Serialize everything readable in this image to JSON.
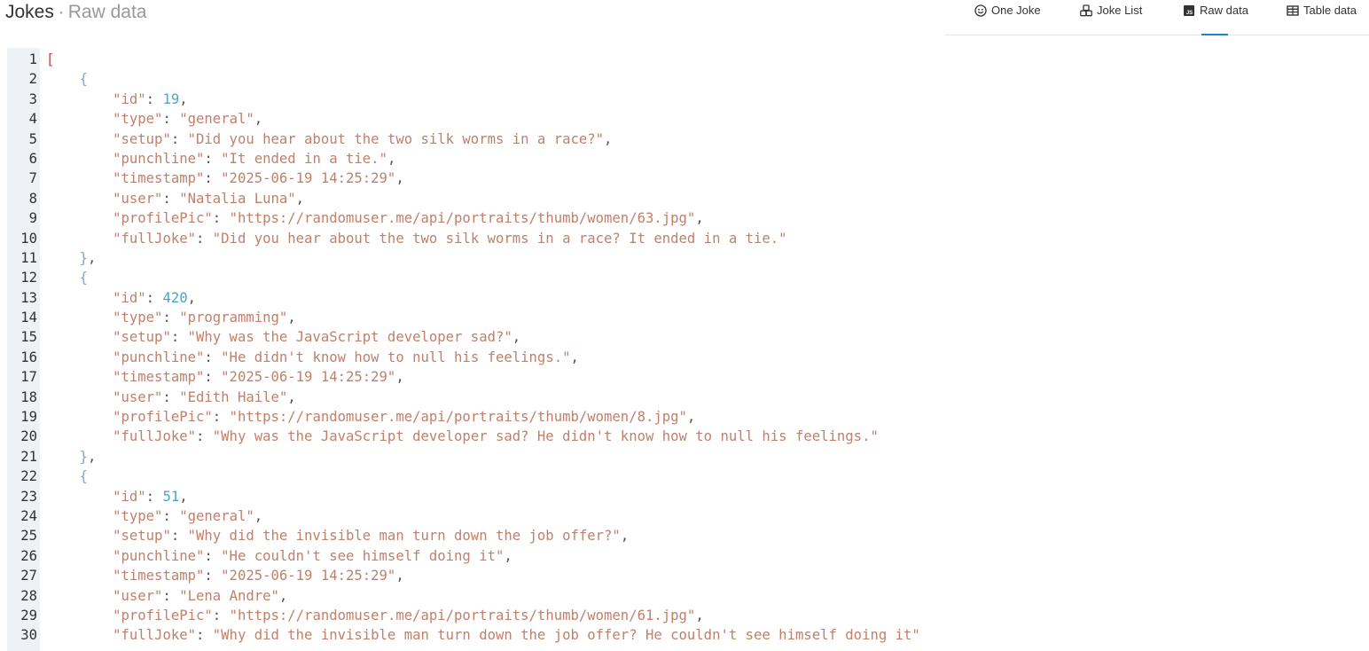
{
  "header": {
    "app": "Jokes",
    "separator": "·",
    "subtitle": "Raw data"
  },
  "tabs": [
    {
      "label": "One Joke",
      "icon": "smiley-icon",
      "active": false
    },
    {
      "label": "Joke List",
      "icon": "cubes-icon",
      "active": false
    },
    {
      "label": "Raw data",
      "icon": "js-file-icon",
      "active": true
    },
    {
      "label": "Table data",
      "icon": "table-icon",
      "active": false
    }
  ],
  "colors": {
    "accent": "#1e88c7",
    "string": "#c0806a",
    "number": "#4fa3c8",
    "gutter": "#eef1f5"
  },
  "code": [
    {
      "n": "1",
      "indent": 0,
      "parts": [
        [
          "bracket",
          "["
        ]
      ]
    },
    {
      "n": "2",
      "indent": 1,
      "parts": [
        [
          "brace",
          "{"
        ]
      ]
    },
    {
      "n": "3",
      "indent": 2,
      "parts": [
        [
          "key",
          "\"id\""
        ],
        [
          "punc",
          ": "
        ],
        [
          "num",
          "19"
        ],
        [
          "punc",
          ","
        ]
      ]
    },
    {
      "n": "4",
      "indent": 2,
      "parts": [
        [
          "key",
          "\"type\""
        ],
        [
          "punc",
          ": "
        ],
        [
          "str",
          "\"general\""
        ],
        [
          "punc",
          ","
        ]
      ]
    },
    {
      "n": "5",
      "indent": 2,
      "parts": [
        [
          "key",
          "\"setup\""
        ],
        [
          "punc",
          ": "
        ],
        [
          "str",
          "\"Did you hear about the two silk worms in a race?\""
        ],
        [
          "punc",
          ","
        ]
      ]
    },
    {
      "n": "6",
      "indent": 2,
      "parts": [
        [
          "key",
          "\"punchline\""
        ],
        [
          "punc",
          ": "
        ],
        [
          "str",
          "\"It ended in a tie.\""
        ],
        [
          "punc",
          ","
        ]
      ]
    },
    {
      "n": "7",
      "indent": 2,
      "parts": [
        [
          "key",
          "\"timestamp\""
        ],
        [
          "punc",
          ": "
        ],
        [
          "str",
          "\"2025-06-19 14:25:29\""
        ],
        [
          "punc",
          ","
        ]
      ]
    },
    {
      "n": "8",
      "indent": 2,
      "parts": [
        [
          "key",
          "\"user\""
        ],
        [
          "punc",
          ": "
        ],
        [
          "str",
          "\"Natalia Luna\""
        ],
        [
          "punc",
          ","
        ]
      ]
    },
    {
      "n": "9",
      "indent": 2,
      "parts": [
        [
          "key",
          "\"profilePic\""
        ],
        [
          "punc",
          ": "
        ],
        [
          "str",
          "\"https://randomuser.me/api/portraits/thumb/women/63.jpg\""
        ],
        [
          "punc",
          ","
        ]
      ]
    },
    {
      "n": "10",
      "indent": 2,
      "parts": [
        [
          "key",
          "\"fullJoke\""
        ],
        [
          "punc",
          ": "
        ],
        [
          "str",
          "\"Did you hear about the two silk worms in a race? It ended in a tie.\""
        ]
      ]
    },
    {
      "n": "11",
      "indent": 1,
      "parts": [
        [
          "brace",
          "}"
        ],
        [
          "punc",
          ","
        ]
      ]
    },
    {
      "n": "12",
      "indent": 1,
      "parts": [
        [
          "brace",
          "{"
        ]
      ]
    },
    {
      "n": "13",
      "indent": 2,
      "parts": [
        [
          "key",
          "\"id\""
        ],
        [
          "punc",
          ": "
        ],
        [
          "num",
          "420"
        ],
        [
          "punc",
          ","
        ]
      ]
    },
    {
      "n": "14",
      "indent": 2,
      "parts": [
        [
          "key",
          "\"type\""
        ],
        [
          "punc",
          ": "
        ],
        [
          "str",
          "\"programming\""
        ],
        [
          "punc",
          ","
        ]
      ]
    },
    {
      "n": "15",
      "indent": 2,
      "parts": [
        [
          "key",
          "\"setup\""
        ],
        [
          "punc",
          ": "
        ],
        [
          "str",
          "\"Why was the JavaScript developer sad?\""
        ],
        [
          "punc",
          ","
        ]
      ]
    },
    {
      "n": "16",
      "indent": 2,
      "parts": [
        [
          "key",
          "\"punchline\""
        ],
        [
          "punc",
          ": "
        ],
        [
          "str",
          "\"He didn't know how to null his feelings.\""
        ],
        [
          "punc",
          ","
        ]
      ]
    },
    {
      "n": "17",
      "indent": 2,
      "parts": [
        [
          "key",
          "\"timestamp\""
        ],
        [
          "punc",
          ": "
        ],
        [
          "str",
          "\"2025-06-19 14:25:29\""
        ],
        [
          "punc",
          ","
        ]
      ]
    },
    {
      "n": "18",
      "indent": 2,
      "parts": [
        [
          "key",
          "\"user\""
        ],
        [
          "punc",
          ": "
        ],
        [
          "str",
          "\"Edith Haile\""
        ],
        [
          "punc",
          ","
        ]
      ]
    },
    {
      "n": "19",
      "indent": 2,
      "parts": [
        [
          "key",
          "\"profilePic\""
        ],
        [
          "punc",
          ": "
        ],
        [
          "str",
          "\"https://randomuser.me/api/portraits/thumb/women/8.jpg\""
        ],
        [
          "punc",
          ","
        ]
      ]
    },
    {
      "n": "20",
      "indent": 2,
      "parts": [
        [
          "key",
          "\"fullJoke\""
        ],
        [
          "punc",
          ": "
        ],
        [
          "str",
          "\"Why was the JavaScript developer sad? He didn't know how to null his feelings.\""
        ]
      ]
    },
    {
      "n": "21",
      "indent": 1,
      "parts": [
        [
          "brace",
          "}"
        ],
        [
          "punc",
          ","
        ]
      ]
    },
    {
      "n": "22",
      "indent": 1,
      "parts": [
        [
          "brace",
          "{"
        ]
      ]
    },
    {
      "n": "23",
      "indent": 2,
      "parts": [
        [
          "key",
          "\"id\""
        ],
        [
          "punc",
          ": "
        ],
        [
          "num",
          "51"
        ],
        [
          "punc",
          ","
        ]
      ]
    },
    {
      "n": "24",
      "indent": 2,
      "parts": [
        [
          "key",
          "\"type\""
        ],
        [
          "punc",
          ": "
        ],
        [
          "str",
          "\"general\""
        ],
        [
          "punc",
          ","
        ]
      ]
    },
    {
      "n": "25",
      "indent": 2,
      "parts": [
        [
          "key",
          "\"setup\""
        ],
        [
          "punc",
          ": "
        ],
        [
          "str",
          "\"Why did the invisible man turn down the job offer?\""
        ],
        [
          "punc",
          ","
        ]
      ]
    },
    {
      "n": "26",
      "indent": 2,
      "parts": [
        [
          "key",
          "\"punchline\""
        ],
        [
          "punc",
          ": "
        ],
        [
          "str",
          "\"He couldn't see himself doing it\""
        ],
        [
          "punc",
          ","
        ]
      ]
    },
    {
      "n": "27",
      "indent": 2,
      "parts": [
        [
          "key",
          "\"timestamp\""
        ],
        [
          "punc",
          ": "
        ],
        [
          "str",
          "\"2025-06-19 14:25:29\""
        ],
        [
          "punc",
          ","
        ]
      ]
    },
    {
      "n": "28",
      "indent": 2,
      "parts": [
        [
          "key",
          "\"user\""
        ],
        [
          "punc",
          ": "
        ],
        [
          "str",
          "\"Lena Andre\""
        ],
        [
          "punc",
          ","
        ]
      ]
    },
    {
      "n": "29",
      "indent": 2,
      "parts": [
        [
          "key",
          "\"profilePic\""
        ],
        [
          "punc",
          ": "
        ],
        [
          "str",
          "\"https://randomuser.me/api/portraits/thumb/women/61.jpg\""
        ],
        [
          "punc",
          ","
        ]
      ]
    },
    {
      "n": "30",
      "indent": 2,
      "parts": [
        [
          "key",
          "\"fullJoke\""
        ],
        [
          "punc",
          ": "
        ],
        [
          "str",
          "\"Why did the invisible man turn down the job offer? He couldn't see himself doing it\""
        ]
      ]
    }
  ]
}
